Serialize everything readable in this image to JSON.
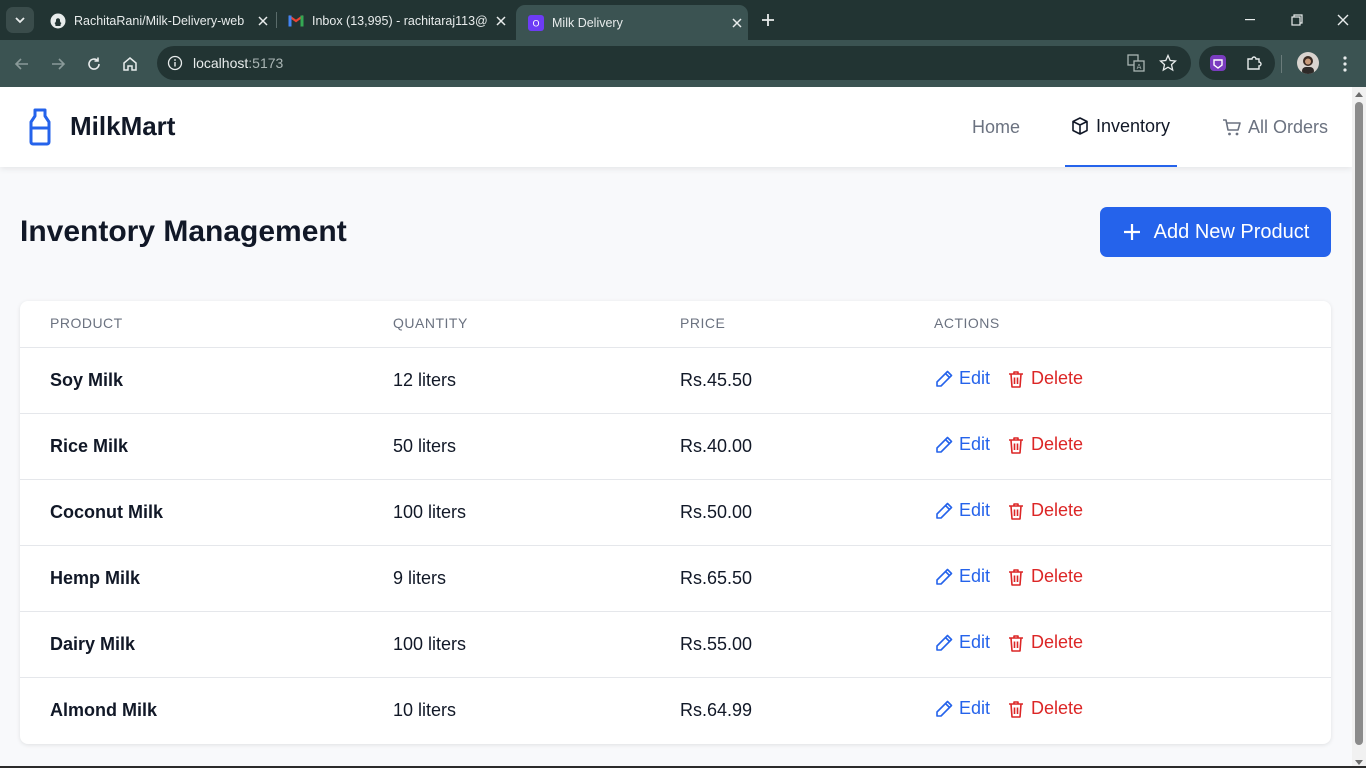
{
  "browser": {
    "tabs": [
      {
        "title": "RachitaRani/Milk-Delivery-web",
        "icon": "github-icon"
      },
      {
        "title": "Inbox (13,995) - rachitaraj113@",
        "icon": "gmail-icon"
      },
      {
        "title": "Milk Delivery",
        "icon": "app-icon",
        "active": true
      }
    ],
    "url_host": "localhost",
    "url_port": ":5173"
  },
  "app": {
    "brand": "MilkMart",
    "brand_color": "#2563eb",
    "nav": [
      {
        "label": "Home",
        "active": false
      },
      {
        "label": "Inventory",
        "active": true,
        "icon": "box-icon"
      },
      {
        "label": "All Orders",
        "active": false,
        "icon": "cart-icon"
      }
    ]
  },
  "page": {
    "title": "Inventory Management",
    "add_button": "Add New Product"
  },
  "table": {
    "headers": [
      "PRODUCT",
      "QUANTITY",
      "PRICE",
      "ACTIONS"
    ],
    "edit_label": "Edit",
    "delete_label": "Delete",
    "rows": [
      {
        "product": "Soy Milk",
        "quantity": "12 liters",
        "price": "Rs.45.50"
      },
      {
        "product": "Rice Milk",
        "quantity": "50 liters",
        "price": "Rs.40.00"
      },
      {
        "product": "Coconut Milk",
        "quantity": "100 liters",
        "price": "Rs.50.00"
      },
      {
        "product": "Hemp Milk",
        "quantity": "9 liters",
        "price": "Rs.65.50"
      },
      {
        "product": "Dairy Milk",
        "quantity": "100 liters",
        "price": "Rs.55.00"
      },
      {
        "product": "Almond Milk",
        "quantity": "10 liters",
        "price": "Rs.64.99"
      }
    ]
  }
}
